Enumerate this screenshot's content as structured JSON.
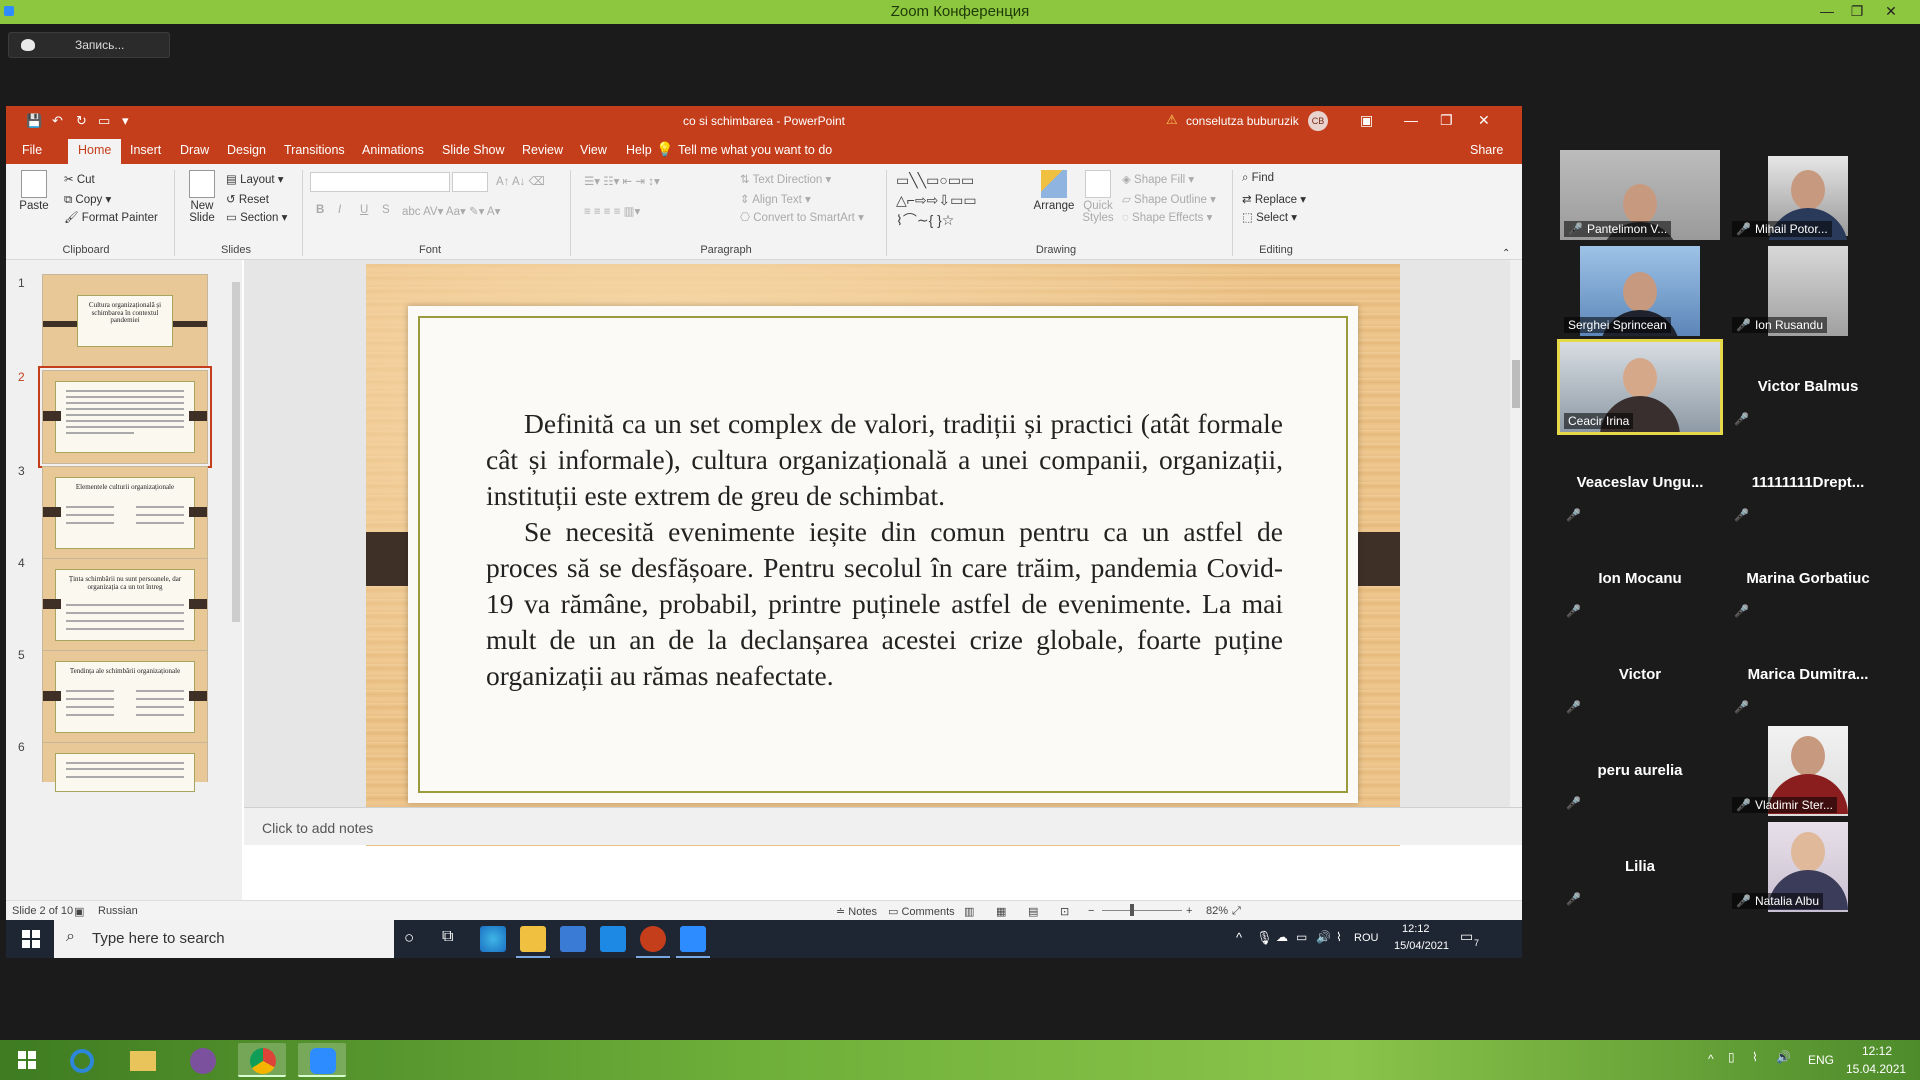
{
  "zoom": {
    "window_title": "Zoom Конференция",
    "recording_label": "Запись...",
    "minimize": "—",
    "maximize": "❐",
    "close": "✕"
  },
  "ppt": {
    "title": "co si schimbarea  -  PowerPoint",
    "user_name": "conselutza buburuzik",
    "user_initials": "CB",
    "tabs": [
      "File",
      "Home",
      "Insert",
      "Draw",
      "Design",
      "Transitions",
      "Animations",
      "Slide Show",
      "Review",
      "View",
      "Help"
    ],
    "active_tab": "Home",
    "tell_me": "Tell me what you want to do",
    "share": "Share",
    "ribbon": {
      "clipboard": {
        "paste": "Paste",
        "cut": "Cut",
        "copy": "Copy",
        "format_painter": "Format Painter",
        "label": "Clipboard"
      },
      "slides": {
        "new_slide": "New Slide",
        "layout": "Layout",
        "reset": "Reset",
        "section": "Section",
        "label": "Slides"
      },
      "font": {
        "label": "Font",
        "bold": "B",
        "italic": "I",
        "underline": "U",
        "strike": "S"
      },
      "paragraph": {
        "text_direction": "Text Direction",
        "align_text": "Align Text",
        "smartart": "Convert to SmartArt",
        "label": "Paragraph"
      },
      "drawing": {
        "arrange": "Arrange",
        "quick_styles": "Quick Styles",
        "shape_fill": "Shape Fill",
        "shape_outline": "Shape Outline",
        "shape_effects": "Shape Effects",
        "label": "Drawing"
      },
      "editing": {
        "find": "Find",
        "replace": "Replace",
        "select": "Select",
        "label": "Editing"
      }
    },
    "thumbnails": [
      {
        "num": "1",
        "title": "Cultura organizațională și schimbarea în contextul pandemiei"
      },
      {
        "num": "2",
        "title": ""
      },
      {
        "num": "3",
        "title": "Elementele culturii organizaționale"
      },
      {
        "num": "4",
        "title": "Ținta schimbării nu sunt persoanele, dar organizația ca un tot întreg"
      },
      {
        "num": "5",
        "title": "Tendința ale schimbării organizaționale"
      },
      {
        "num": "6",
        "title": ""
      }
    ],
    "selected_slide": 2,
    "slide_paragraphs": [
      "Definită ca un set complex de valori, tradiții și practici (atât formale cât și informale), cultura organizațională a unei companii, organizații, instituții este extrem de greu de schimbat.",
      "Se necesită evenimente ieșite din comun pentru ca un astfel de proces să se desfășoare. Pentru secolul în care trăim, pandemia Covid-19 va rămâne, probabil, printre puținele astfel de evenimente. La mai mult de un an de la declanșarea acestei crize globale, foarte puține organizații au rămas neafectate."
    ],
    "notes_placeholder": "Click to add notes",
    "status": {
      "slide_count": "Slide 2 of 10",
      "language": "Russian",
      "notes": "Notes",
      "comments": "Comments",
      "zoom": "82%"
    }
  },
  "inner_taskbar": {
    "search_placeholder": "Type here to search",
    "lang": "ROU",
    "time": "12:12",
    "date": "15/04/2021",
    "notif_count": "7"
  },
  "participants": [
    {
      "name": "Pantelimon V...",
      "video": true,
      "muted": true
    },
    {
      "name": "Mihail Potor...",
      "video": true,
      "muted": true
    },
    {
      "name": "Serghei Sprincean",
      "video": true,
      "muted": false
    },
    {
      "name": "Ion Rusandu",
      "video": true,
      "muted": true
    },
    {
      "name": "Ceacir Irina",
      "video": true,
      "muted": false
    },
    {
      "name": "Victor Balmus",
      "video": false,
      "muted": true
    },
    {
      "name": "Veaceslav  Ungu...",
      "video": false,
      "muted": true
    },
    {
      "name": "11111111Drept...",
      "video": false,
      "muted": true
    },
    {
      "name": "Ion Mocanu",
      "video": false,
      "muted": true
    },
    {
      "name": "Marina Gorbatiuc",
      "video": false,
      "muted": true
    },
    {
      "name": "Victor",
      "video": false,
      "muted": true
    },
    {
      "name": "Marica  Dumitra...",
      "video": false,
      "muted": true
    },
    {
      "name": "peru aurelia",
      "video": false,
      "muted": true
    },
    {
      "name": "Vladimir Ster...",
      "video": true,
      "muted": true
    },
    {
      "name": "Lilia",
      "video": false,
      "muted": true
    },
    {
      "name": "Natalia Albu",
      "video": true,
      "muted": true
    }
  ],
  "outer_taskbar": {
    "lang": "ENG",
    "time": "12:12",
    "date": "15.04.2021"
  },
  "colors": {
    "zoom_green": "#8dc63f",
    "ppt_red": "#c43e1c",
    "muted_red": "#e0323a",
    "speaker_highlight": "#e6d94a"
  }
}
